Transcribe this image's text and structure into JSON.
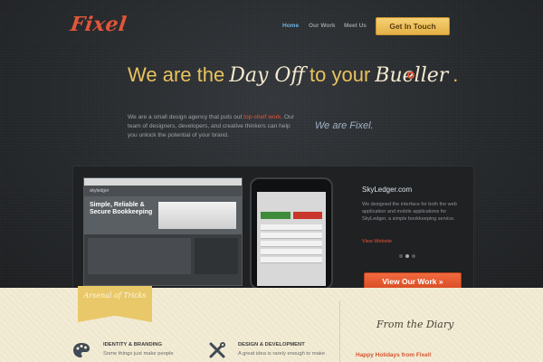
{
  "brand": {
    "logo_text": "Fixel",
    "accent_color": "#e2563a"
  },
  "nav": {
    "items": [
      "Home",
      "Our Work",
      "Meet Us"
    ],
    "active": "Home",
    "cta": "Get In Touch"
  },
  "hero": {
    "headline_start": "We are the",
    "headline_script_1": "Day Off",
    "headline_middle": "to your",
    "headline_script_2": "Bueller",
    "headline_end": ".",
    "intro_before": "We are a small design agency that puts out ",
    "intro_highlight": "top-shelf work",
    "intro_after": ". Our team of designers, developers, and creative thinkers can help you unlock the potential of your brand.",
    "tagline": "We are Fixel."
  },
  "showcase": {
    "laptop_brand": "skyledger",
    "laptop_headline": "Simple, Reliable & Secure Bookkeeping",
    "project_title": "SkyLedger.com",
    "project_desc": "We designed the interface for both the web application and mobile applications for SkyLedger, a simple bookkeeping service.",
    "project_link": "View Website",
    "slides_count": 3,
    "active_slide": 2,
    "view_work_button": "View Our Work »"
  },
  "arsenal": {
    "ribbon_title": "Arsenal of Tricks",
    "services": [
      {
        "title": "IDENTITY & BRANDING",
        "desc": "Some things just make people",
        "icon": "palette-icon"
      },
      {
        "title": "DESIGN & DEVELOPMENT",
        "desc": "A great idea is rarely enough to make",
        "icon": "tools-icon"
      }
    ]
  },
  "diary": {
    "title": "From the Diary",
    "latest_post": "Happy Holidays from Fixel!"
  }
}
